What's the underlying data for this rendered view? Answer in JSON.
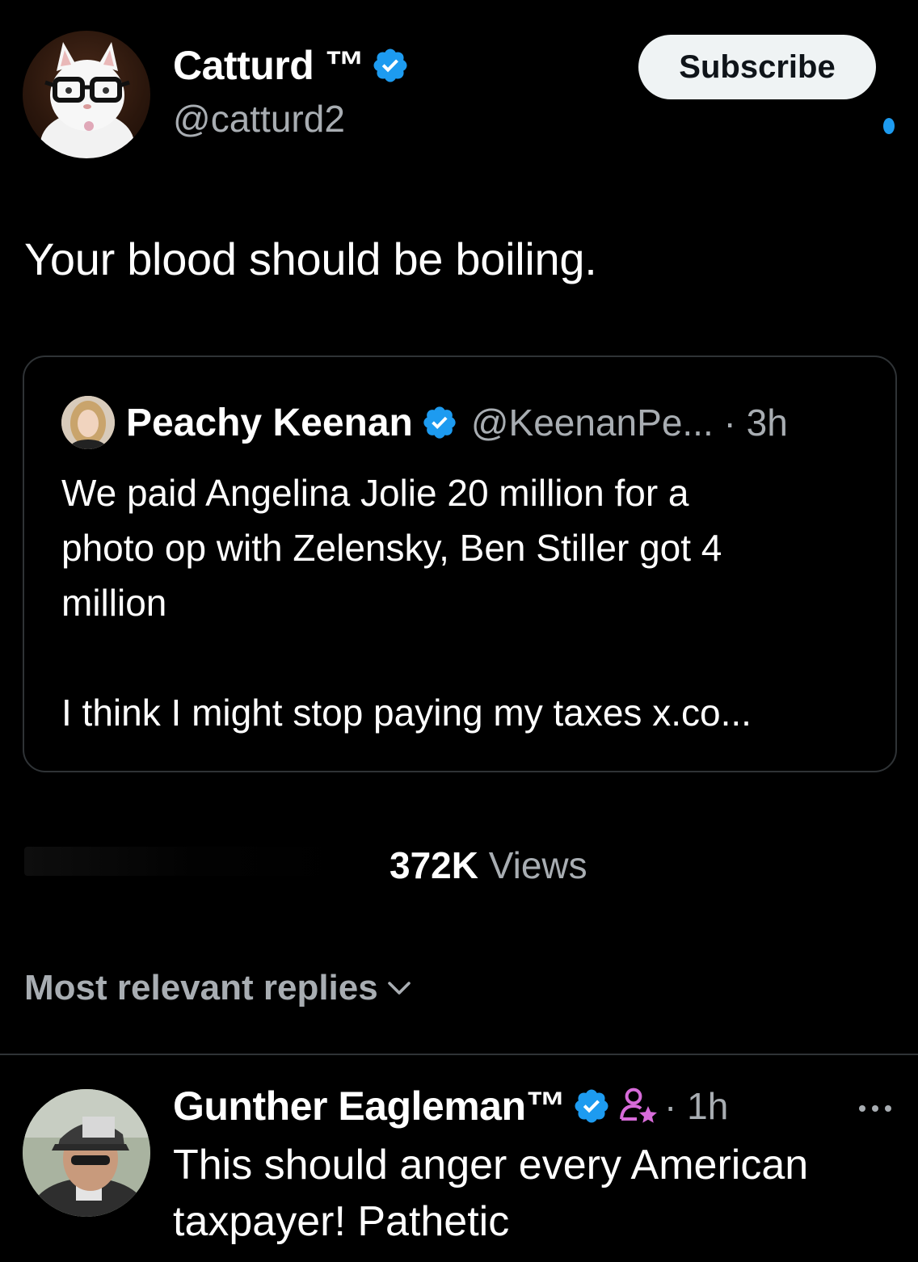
{
  "author": {
    "name": "Catturd ™",
    "handle": "@catturd2",
    "subscribe_label": "Subscribe"
  },
  "tweet": {
    "text": "Your blood should be boiling."
  },
  "quote": {
    "name": "Peachy Keenan",
    "meta": "@KeenanPe... · 3h",
    "lines": [
      "We paid Angelina Jolie 20 million for a",
      "photo op with Zelensky, Ben Stiller got 4",
      "million",
      "",
      "I think I might stop paying my taxes x.co..."
    ]
  },
  "stats": {
    "views_count": "372K",
    "views_label": "Views"
  },
  "replies": {
    "sort_label": "Most relevant replies"
  },
  "reply": {
    "name": "Gunther Eagleman™",
    "time": "· 1h",
    "lines": [
      "This should anger every American",
      "taxpayer!  Pathetic"
    ]
  },
  "colors": {
    "background": "#000000",
    "verified_blue": "#1d9bf0",
    "muted_text": "#a8adb2",
    "border": "#2f3336",
    "affiliate_pink": "#d76bd9"
  },
  "icons": {
    "verified": "verified-badge-icon",
    "chevron": "chevron-down-icon",
    "affiliate": "affiliate-badge-icon",
    "more": "more-options-icon"
  }
}
